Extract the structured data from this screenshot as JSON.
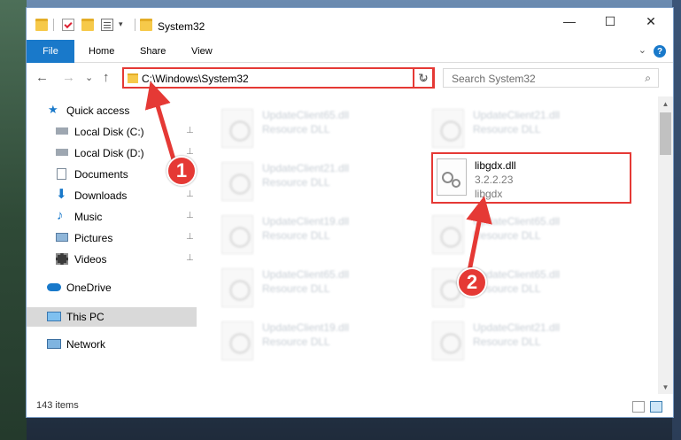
{
  "window": {
    "title": "System32",
    "controls": {
      "minimize": "—",
      "maximize": "☐",
      "close": "✕"
    }
  },
  "ribbon": {
    "tabs": [
      "File",
      "Home",
      "Share",
      "View"
    ],
    "help": "?",
    "expand": "⌄"
  },
  "nav": {
    "back": "←",
    "forward": "→",
    "recent": "⌄",
    "up": "↑",
    "address": "C:\\Windows\\System32",
    "address_dropdown": "⌄",
    "refresh": "↻",
    "search_placeholder": "Search System32",
    "search_icon": "⌕"
  },
  "sidebar": {
    "items": [
      {
        "label": "Quick access",
        "icon": "star-icon"
      },
      {
        "label": "Local Disk (C:)",
        "icon": "drive-icon",
        "pinned": true
      },
      {
        "label": "Local Disk (D:)",
        "icon": "drive-icon",
        "pinned": true
      },
      {
        "label": "Documents",
        "icon": "documents-icon",
        "pinned": true
      },
      {
        "label": "Downloads",
        "icon": "download-icon",
        "pinned": true
      },
      {
        "label": "Music",
        "icon": "music-icon",
        "pinned": true
      },
      {
        "label": "Pictures",
        "icon": "pictures-icon",
        "pinned": true
      },
      {
        "label": "Videos",
        "icon": "videos-icon",
        "pinned": true
      },
      {
        "label": "OneDrive",
        "icon": "cloud-icon"
      },
      {
        "label": "This PC",
        "icon": "computer-icon",
        "selected": true
      },
      {
        "label": "Network",
        "icon": "network-icon"
      }
    ],
    "pin_glyph": "📌"
  },
  "files": {
    "left_column": [
      {
        "name": "UpdateClient65.dll",
        "type": "Resource DLL"
      },
      {
        "name": "UpdateClient21.dll",
        "type": "Resource DLL"
      },
      {
        "name": "UpdateClient19.dll",
        "type": "Resource DLL"
      },
      {
        "name": "UpdateClient65.dll",
        "type": "Resource DLL"
      },
      {
        "name": "UpdateClient19.dll",
        "type": "Resource DLL"
      }
    ],
    "right_column": [
      {
        "name": "UpdateClient21.dll",
        "type": "Resource DLL"
      },
      {
        "name": "UpdateClient65.dll",
        "type": "Resource DLL"
      },
      {
        "name": "UpdateClient65.dll",
        "type": "Resource DLL"
      },
      {
        "name": "UpdateClient21.dll",
        "type": "Resource DLL"
      }
    ],
    "highlighted": {
      "name": "libgdx.dll",
      "version": "3.2.2.23",
      "description": "libgdx"
    }
  },
  "status": {
    "item_count": "143 items"
  },
  "callouts": [
    "1",
    "2"
  ],
  "colors": {
    "accent": "#1979ca",
    "callout": "#e53935",
    "folder": "#f6c94a"
  }
}
